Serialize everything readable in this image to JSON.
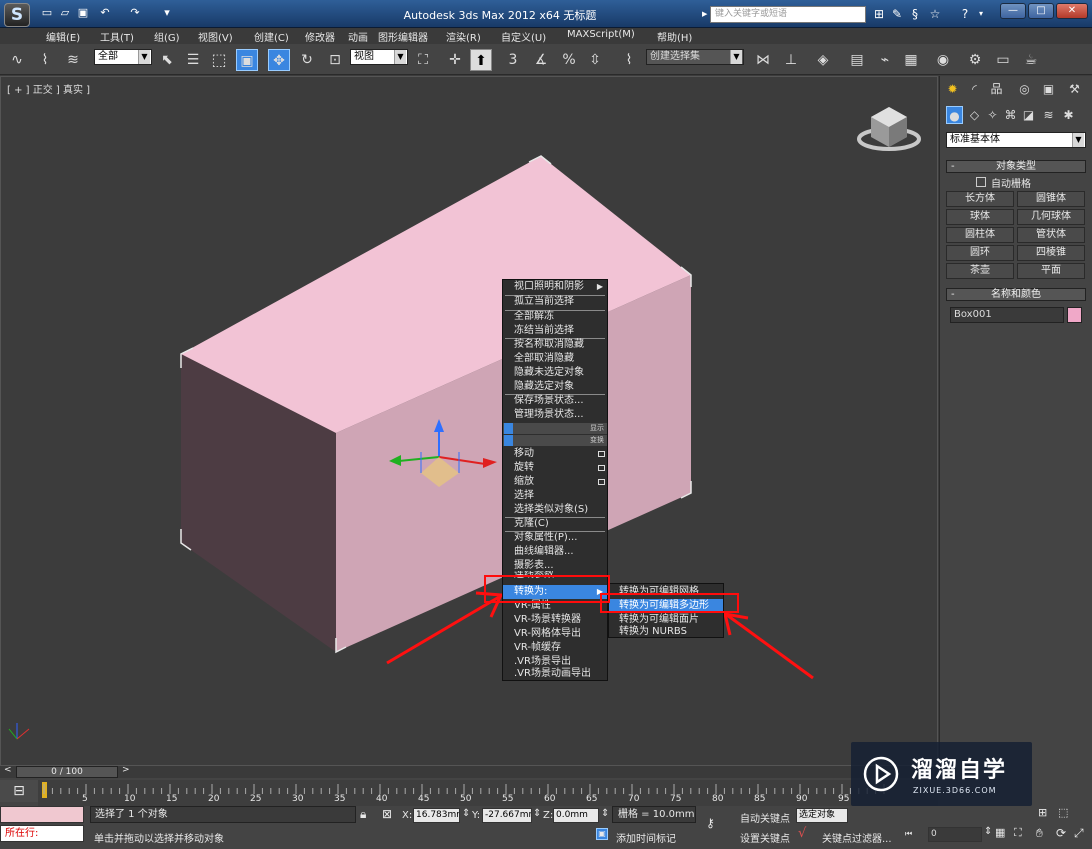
{
  "app": {
    "logo": "S",
    "title": "Autodesk 3ds Max  2012 x64     无标题",
    "search_placeholder": "键入关键字或短语"
  },
  "menu": [
    "编辑(E)",
    "工具(T)",
    "组(G)",
    "视图(V)",
    "创建(C)",
    "修改器",
    "动画",
    "图形编辑器",
    "渲染(R)",
    "自定义(U)",
    "MAXScript(M)",
    "帮助(H)"
  ],
  "toolbar": {
    "selection_filter": "全部",
    "ref_coord": "视图",
    "named_selection": "创建选择集",
    "snap_3": "3",
    "snap_pct": "%"
  },
  "viewport": {
    "label": "[ + ] 正交 ] 真实 ]"
  },
  "context_menu": {
    "group1": [
      "视口照明和阴影",
      "孤立当前选择",
      "全部解冻",
      "冻结当前选择",
      "按名称取消隐藏",
      "全部取消隐藏",
      "隐藏未选定对象",
      "隐藏选定对象",
      "保存场景状态...",
      "管理场景状态..."
    ],
    "quad_labels": [
      "显示",
      "变换"
    ],
    "group2": [
      "移动",
      "旋转",
      "缩放",
      "选择",
      "选择类似对象(S)",
      "克隆(C)",
      "对象属性(P)...",
      "曲线编辑器...",
      "摄影表...",
      "连线参数...",
      "转换为:",
      "VR-属性",
      "VR-场景转换器",
      "VR-网格体导出",
      "VR-帧缓存",
      ".VR场景导出",
      ".VR场景动画导出"
    ]
  },
  "convert_submenu": [
    "转换为可编辑网格",
    "转换为可编辑多边形",
    "转换为可编辑面片",
    "转换为 NURBS"
  ],
  "command_panel": {
    "category": "标准基本体",
    "object_type_header": "对象类型",
    "autogrid": "自动栅格",
    "object_buttons": [
      "长方体",
      "圆锥体",
      "球体",
      "几何球体",
      "圆柱体",
      "管状体",
      "圆环",
      "四棱锥",
      "茶壶",
      "平面"
    ],
    "name_color_header": "名称和颜色",
    "object_name": "Box001",
    "object_color": "#f0a8c8"
  },
  "timeline": {
    "frame": "0 / 100",
    "ticks": [
      "5",
      "10",
      "15",
      "20",
      "25",
      "30",
      "35",
      "40",
      "45",
      "50",
      "55",
      "60",
      "65",
      "70",
      "75",
      "80",
      "85",
      "90",
      "95"
    ]
  },
  "status": {
    "selection": "选择了 1 个对象",
    "prompt": "单击并拖动以选择并移动对象",
    "script_label": "所在行:",
    "x_label": "X:",
    "x_value": "16.783mm",
    "y_label": "Y:",
    "y_value": "-27.667mm",
    "z_label": "Z:",
    "z_value": "0.0mm",
    "grid": "栅格 = 10.0mm",
    "auto_key": "自动关键点",
    "selected_mode": "选定对象",
    "set_key": "设置关键点",
    "key_filters": "关键点过滤器...",
    "add_time_tag": "添加时间标记",
    "frame_value": "0"
  },
  "watermark": {
    "name": "溜溜自学",
    "url": "ZIXUE.3D66.COM"
  }
}
